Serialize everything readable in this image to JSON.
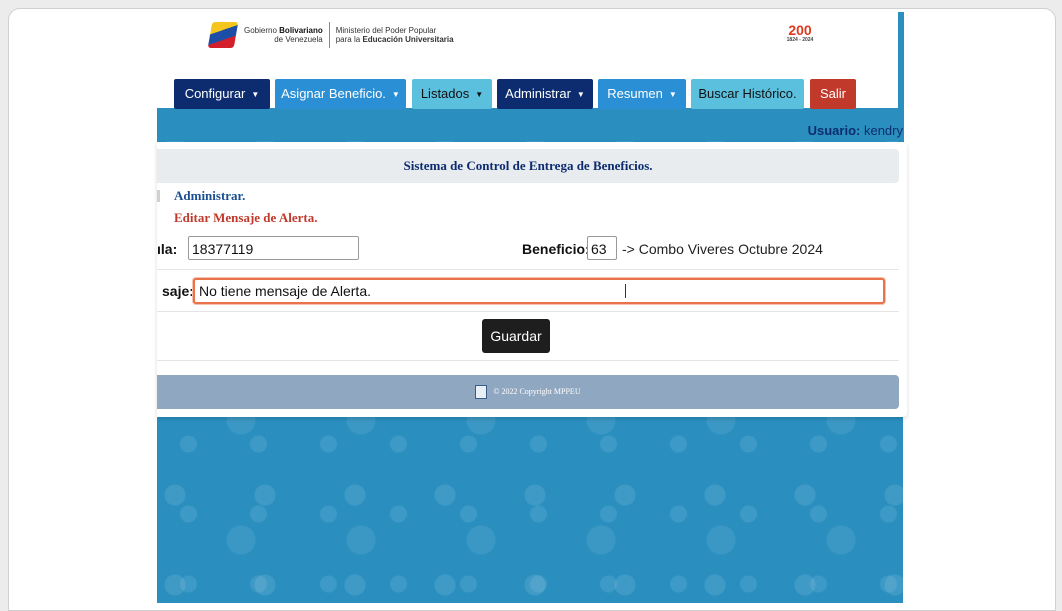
{
  "header": {
    "gov_line1": "Gobierno",
    "gov_bold": "Bolivariano",
    "gov_line2": "de Venezuela",
    "ministry_line1": "Ministerio del Poder Popular",
    "ministry_line2_prefix": "para la",
    "ministry_line2_bold": "Educación Universitaria",
    "anniv_logo_number": "200",
    "anniv_logo_sub": "1824 - 2024"
  },
  "nav": {
    "configurar": "Configurar",
    "asignar": "Asignar Beneficio.",
    "listados": "Listados",
    "administrar": "Administrar",
    "resumen": "Resumen",
    "buscar": "Buscar Histórico.",
    "salir": "Salir"
  },
  "user": {
    "label": "Usuario:",
    "name": "kendry"
  },
  "page": {
    "title": "Sistema de Control de Entrega de Beneficios.",
    "breadcrumb1": "Administrar.",
    "breadcrumb2": "Editar Mensaje de Alerta."
  },
  "form": {
    "cedula_label": "ıla:",
    "cedula_value": "18377119",
    "beneficio_label": "Beneficio:",
    "beneficio_value": "63",
    "beneficio_desc": "-> Combo Viveres Octubre 2024",
    "mensaje_label": "saje:",
    "mensaje_value": "No tiene mensaje de Alerta.",
    "save_label": "Guardar"
  },
  "footer": {
    "copyright": "© 2022 Copyright MPPEU"
  },
  "colors": {
    "nav_dark": "#0c2c6f",
    "nav_light": "#2a8fd4",
    "nav_cyan": "#5bc0de",
    "nav_red": "#c0392b",
    "focus": "#e8734a"
  }
}
